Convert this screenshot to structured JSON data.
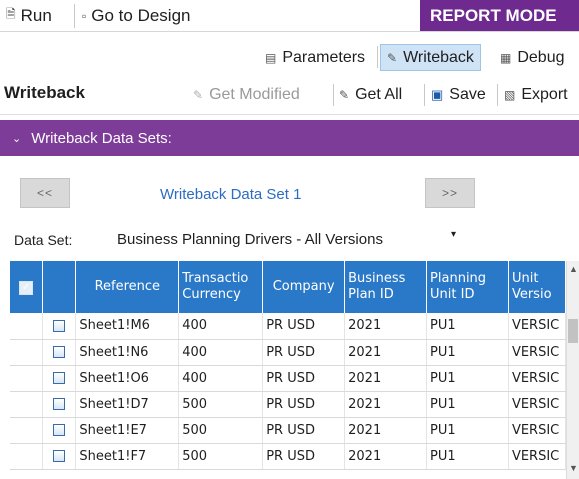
{
  "toolbar_top": {
    "run_label": "Run",
    "design_label": "Go to Design",
    "mode_label": "REPORT MODE"
  },
  "tabs": {
    "parameters_label": "Parameters",
    "writeback_label": "Writeback",
    "debug_label": "Debug"
  },
  "writeback_bar": {
    "title": "Writeback",
    "get_modified_label": "Get Modified",
    "get_all_label": "Get All",
    "save_label": "Save",
    "export_label": "Export"
  },
  "section": {
    "title": "Writeback Data Sets:"
  },
  "navigator": {
    "prev_label": "<<",
    "next_label": ">>",
    "current_label": "Writeback Data Set 1"
  },
  "dataset": {
    "label": "Data Set:",
    "value": "Business Planning Drivers - All Versions"
  },
  "grid": {
    "headers": {
      "reference": "Reference",
      "transaction_currency_1": "Transactio",
      "transaction_currency_2": "Currency",
      "company": "Company",
      "business_plan_1": "Business",
      "business_plan_2": "Plan ID",
      "planning_unit_1": "Planning",
      "planning_unit_2": "Unit ID",
      "unit_version_1": "Unit",
      "unit_version_2": "Versio"
    },
    "rows": [
      {
        "reference": "Sheet1!M6",
        "currency": "400",
        "company": "PR USD",
        "plan_id": "2021",
        "unit_id": "PU1",
        "version": "VERSIC"
      },
      {
        "reference": "Sheet1!N6",
        "currency": "400",
        "company": "PR USD",
        "plan_id": "2021",
        "unit_id": "PU1",
        "version": "VERSIC"
      },
      {
        "reference": "Sheet1!O6",
        "currency": "400",
        "company": "PR USD",
        "plan_id": "2021",
        "unit_id": "PU1",
        "version": "VERSIC"
      },
      {
        "reference": "Sheet1!D7",
        "currency": "500",
        "company": "PR USD",
        "plan_id": "2021",
        "unit_id": "PU1",
        "version": "VERSIC"
      },
      {
        "reference": "Sheet1!E7",
        "currency": "500",
        "company": "PR USD",
        "plan_id": "2021",
        "unit_id": "PU1",
        "version": "VERSIC"
      },
      {
        "reference": "Sheet1!F7",
        "currency": "500",
        "company": "PR USD",
        "plan_id": "2021",
        "unit_id": "PU1",
        "version": "VERSIC"
      }
    ]
  },
  "icons": {
    "run": "document-icon",
    "design": "design-icon",
    "parameters": "parameters-icon",
    "writeback": "writeback-icon",
    "debug": "debug-icon",
    "get_modified": "get-modified-icon",
    "get_all": "get-all-icon",
    "save": "save-icon",
    "export": "export-icon"
  },
  "colors": {
    "report_mode_bg": "#6e2a8f",
    "section_bg": "#7d3c98",
    "grid_header_bg": "#2a78c8",
    "link_blue": "#2b6cc4",
    "active_tab_bg": "#cfe3f7"
  }
}
